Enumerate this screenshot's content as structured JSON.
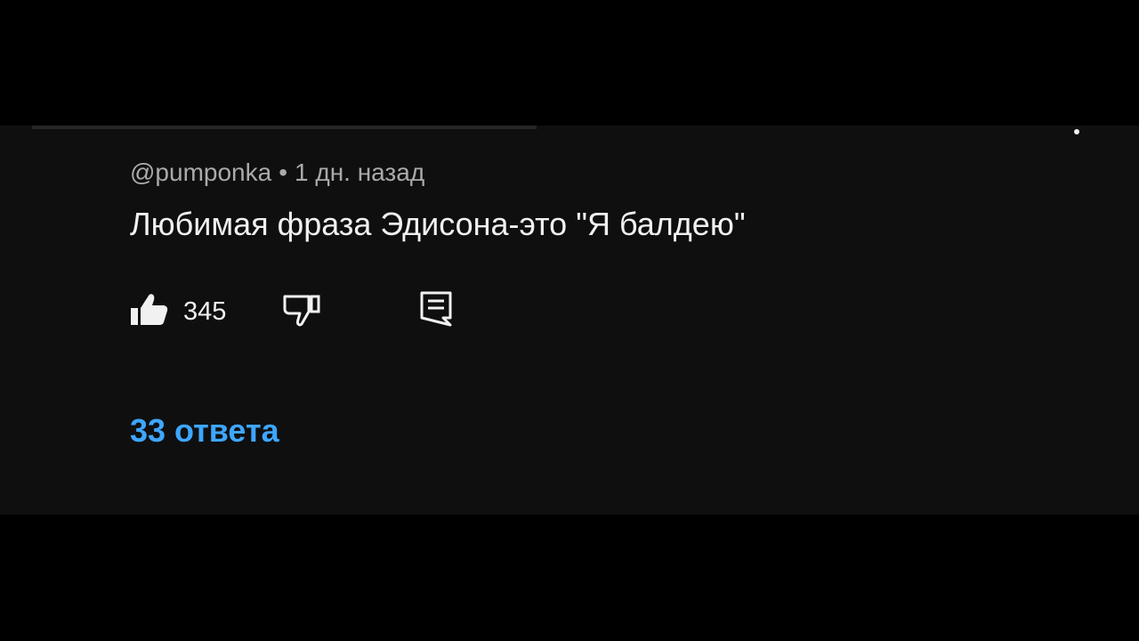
{
  "comment": {
    "author": "@pumponka",
    "separator": "•",
    "timestamp": "1 дн. назад",
    "text": "Любимая фраза Эдисона-это \"Я балдею\"",
    "like_count": "345",
    "replies_label": "33 ответа"
  },
  "icons": {
    "like": "thumbs-up-icon",
    "dislike": "thumbs-down-icon",
    "reply": "reply-comment-icon",
    "menu": "more-options-icon"
  },
  "colors": {
    "background": "#0f0f0f",
    "text_primary": "#f1f1f1",
    "text_secondary": "#aaaaaa",
    "link_accent": "#3ea6ff"
  }
}
